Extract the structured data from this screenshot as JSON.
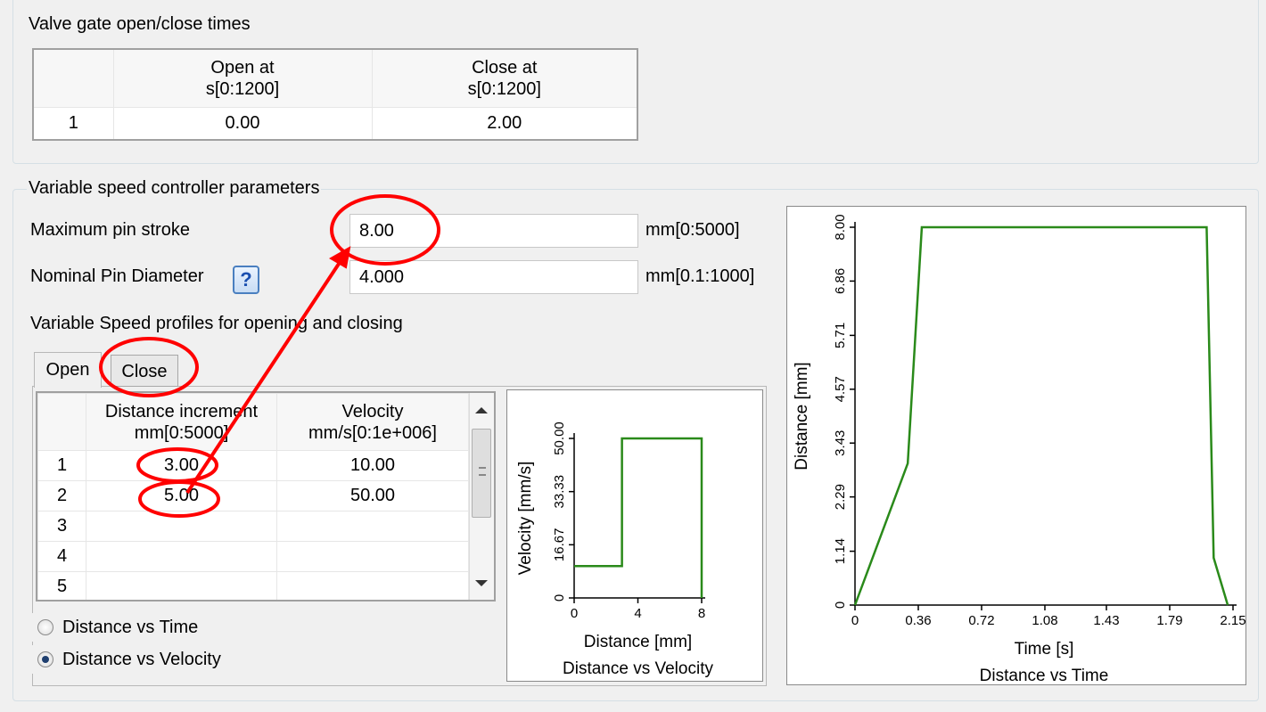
{
  "valve_gate": {
    "title": "Valve gate open/close times",
    "headers": [
      {
        "line1": "",
        "line2": ""
      },
      {
        "line1": "Open at",
        "line2": "s[0:1200]"
      },
      {
        "line1": "Close at",
        "line2": "s[0:1200]"
      }
    ],
    "rows": [
      {
        "index": "1",
        "open": "0.00",
        "close": "2.00"
      }
    ]
  },
  "controller": {
    "title": "Variable speed controller parameters",
    "max_stroke_label": "Maximum pin stroke",
    "max_stroke_value": "8.00",
    "max_stroke_unit": "mm[0:5000]",
    "pin_diameter_label": "Nominal Pin Diameter",
    "pin_diameter_value": "4.000",
    "pin_diameter_unit": "mm[0.1:1000]",
    "help_glyph": "?",
    "profiles_label": "Variable Speed profiles for opening and closing",
    "tabs": [
      "Open",
      "Close"
    ],
    "speed_table": {
      "headers": [
        {
          "line1": "",
          "line2": ""
        },
        {
          "line1": "Distance increment",
          "line2": "mm[0:5000]"
        },
        {
          "line1": "Velocity",
          "line2": "mm/s[0:1e+006]"
        }
      ],
      "rows": [
        {
          "index": "1",
          "distance": "3.00",
          "velocity": "10.00"
        },
        {
          "index": "2",
          "distance": "5.00",
          "velocity": "50.00"
        },
        {
          "index": "3",
          "distance": "",
          "velocity": ""
        },
        {
          "index": "4",
          "distance": "",
          "velocity": ""
        },
        {
          "index": "5",
          "distance": "",
          "velocity": ""
        }
      ]
    },
    "radios": [
      {
        "label": "Distance vs Time",
        "checked": false
      },
      {
        "label": "Distance vs Velocity",
        "checked": true
      }
    ]
  },
  "annotation_color": "#ff0000",
  "line_color": "#2a8a1a",
  "chart_data": [
    {
      "type": "line",
      "title": "Distance vs Velocity",
      "xlabel": "Distance [mm]",
      "ylabel": "Velocity [mm/s]",
      "xlim": [
        0,
        8
      ],
      "ylim": [
        0,
        50
      ],
      "x_ticks": [
        "0",
        "4",
        "8"
      ],
      "y_ticks": [
        "0",
        "16.67",
        "33.33",
        "50.00"
      ],
      "series": [
        {
          "x": [
            0,
            3,
            3,
            8,
            8
          ],
          "y": [
            10,
            10,
            50,
            50,
            0
          ]
        }
      ]
    },
    {
      "type": "line",
      "title": "Distance vs Time",
      "xlabel": "Time [s]",
      "ylabel": "Distance [mm]",
      "xlim": [
        0,
        2.15
      ],
      "ylim": [
        0,
        8
      ],
      "x_ticks": [
        "0",
        "0.36",
        "0.72",
        "1.08",
        "1.43",
        "1.79",
        "2.15"
      ],
      "y_ticks": [
        "0",
        "1.14",
        "2.29",
        "3.43",
        "4.57",
        "5.71",
        "6.86",
        "8.00"
      ],
      "series": [
        {
          "x": [
            0,
            0.3,
            0.38,
            2.0,
            2.04,
            2.12
          ],
          "y": [
            0,
            3,
            8,
            8,
            1,
            0
          ]
        }
      ]
    }
  ]
}
